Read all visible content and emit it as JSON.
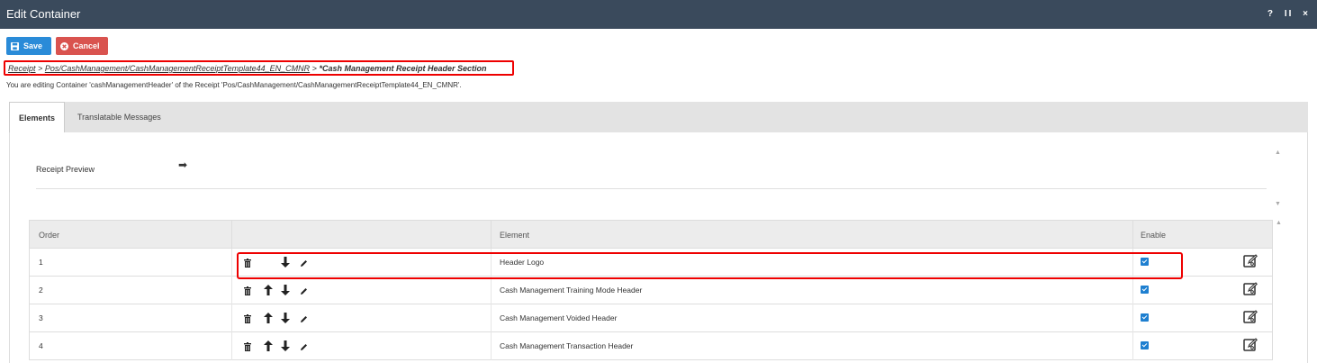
{
  "window": {
    "title": "Edit Container",
    "controls": [
      "?",
      "II",
      "×"
    ]
  },
  "toolbar": {
    "save_label": "Save",
    "cancel_label": "Cancel"
  },
  "breadcrumb": {
    "root": "Receipt",
    "sep1": ">",
    "template": "Pos/CashManagement/CashManagementReceiptTemplate44_EN_CMNR",
    "sep2": ">",
    "current": "*Cash Management Receipt Header Section"
  },
  "info_text": "You are editing Container 'cashManagementHeader' of the Receipt 'Pos/CashManagement/CashManagementReceiptTemplate44_EN_CMNR'.",
  "tabs": [
    {
      "label": "Elements",
      "active": true
    },
    {
      "label": "Translatable Messages",
      "active": false
    }
  ],
  "preview": {
    "label": "Receipt Preview",
    "arrow": "➡"
  },
  "table": {
    "columns": {
      "order": "Order",
      "actions": "",
      "element": "Element",
      "enable": "Enable"
    },
    "rows": [
      {
        "order": "1",
        "element": "Header Logo",
        "enabled": true,
        "can_move_up": false
      },
      {
        "order": "2",
        "element": "Cash Management Training Mode Header",
        "enabled": true,
        "can_move_up": true
      },
      {
        "order": "3",
        "element": "Cash Management Voided Header",
        "enabled": true,
        "can_move_up": true
      },
      {
        "order": "4",
        "element": "Cash Management Transaction Header",
        "enabled": true,
        "can_move_up": true
      }
    ]
  },
  "colors": {
    "titlebar": "#3a4a5c",
    "save": "#2a8bd8",
    "cancel": "#d9534f",
    "highlight": "#e00000",
    "checkbox": "#1e7fd0"
  }
}
